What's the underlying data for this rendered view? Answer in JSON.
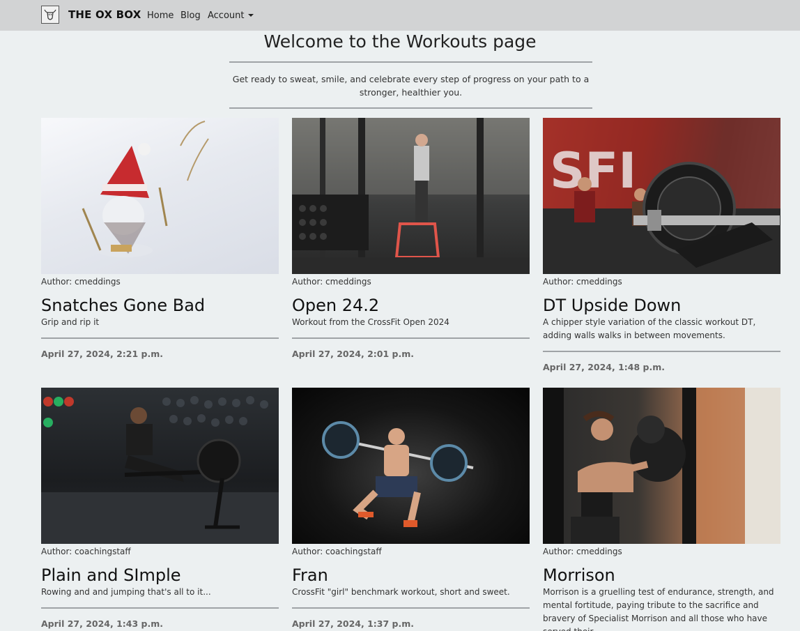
{
  "nav": {
    "brand": "THE OX BOX",
    "links": [
      "Home",
      "Blog"
    ],
    "account_label": "Account"
  },
  "header": {
    "title": "Welcome to the Workouts page",
    "intro": "Get ready to sweat, smile, and celebrate every step of progress on your path to a stronger, healthier you."
  },
  "posts": [
    {
      "author": "Author: cmeddings",
      "title": "Snatches Gone Bad",
      "desc": "Grip and rip it",
      "date": "April 27, 2024, 2:21 p.m."
    },
    {
      "author": "Author: cmeddings",
      "title": "Open 24.2",
      "desc": "Workout from the CrossFit Open 2024",
      "date": "April 27, 2024, 2:01 p.m."
    },
    {
      "author": "Author: cmeddings",
      "title": "DT Upside Down",
      "desc": "A chipper style variation of the classic workout DT, adding walls walks in between movements.",
      "date": "April 27, 2024, 1:48 p.m."
    },
    {
      "author": "Author: coachingstaff",
      "title": "Plain and SImple",
      "desc": "Rowing and and jumping that's all to it...",
      "date": "April 27, 2024, 1:43 p.m."
    },
    {
      "author": "Author: coachingstaff",
      "title": "Fran",
      "desc": "CrossFit \"girl\" benchmark workout, short and sweet.",
      "date": "April 27, 2024, 1:37 p.m."
    },
    {
      "author": "Author: cmeddings",
      "title": "Morrison",
      "desc": "Morrison is a gruelling test of endurance, strength, and mental fortitude, paying tribute to the sacrifice and bravery of Specialist Morrison and all those who have served their",
      "date": ""
    }
  ]
}
